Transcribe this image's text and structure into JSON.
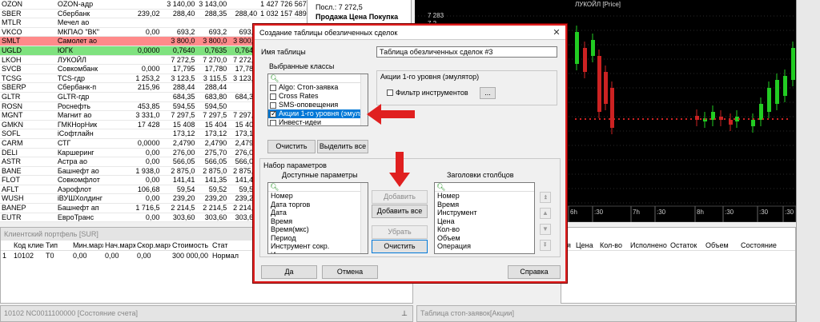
{
  "quotes": [
    {
      "code": "OZON",
      "name": "OZON-адр",
      "c2": "",
      "c3": "3 140,00",
      "c4": "3 143,00",
      "c5": "",
      "c6": "1 427 726 567",
      "style": ""
    },
    {
      "code": "SBER",
      "name": "Сбербанк",
      "c2": "239,02",
      "c3": "288,40",
      "c4": "288,35",
      "c5": "288,40",
      "c6": "1 032 157 489",
      "style": ""
    },
    {
      "code": "MTLR",
      "name": "Мечел ао",
      "c2": "",
      "c3": "",
      "c4": "",
      "c5": "",
      "c6": "",
      "style": ""
    },
    {
      "code": "VKCO",
      "name": "МКПАО \"ВК\"",
      "c2": "0,00",
      "c3": "693,2",
      "c4": "693,2",
      "c5": "693,2",
      "c6": "",
      "style": ""
    },
    {
      "code": "SMLT",
      "name": "Самолет ао",
      "c2": "",
      "c3": "3 800,0",
      "c4": "3 800,0",
      "c5": "3 800,0",
      "c6": "",
      "style": "red"
    },
    {
      "code": "UGLD",
      "name": "ЮГК",
      "c2": "0,0000",
      "c3": "0,7640",
      "c4": "0,7635",
      "c5": "0,7640",
      "c6": "",
      "style": "green"
    },
    {
      "code": "LKOH",
      "name": "ЛУКОЙЛ",
      "c2": "",
      "c3": "7 272,5",
      "c4": "7 270,0",
      "c5": "7 272,5",
      "c6": "",
      "style": ""
    },
    {
      "code": "SVCB",
      "name": "Совкомбанк",
      "c2": "0,000",
      "c3": "17,795",
      "c4": "17,780",
      "c5": "17,780",
      "c6": "",
      "style": ""
    },
    {
      "code": "TCSG",
      "name": "TCS-гдр",
      "c2": "1 253,2",
      "c3": "3 123,5",
      "c4": "3 115,5",
      "c5": "3 123,5",
      "c6": "",
      "style": ""
    },
    {
      "code": "SBERP",
      "name": "Сбербанк-п",
      "c2": "215,96",
      "c3": "288,44",
      "c4": "288,44",
      "c5": "",
      "c6": "",
      "style": ""
    },
    {
      "code": "GLTR",
      "name": "GLTR-гдр",
      "c2": "",
      "c3": "684,35",
      "c4": "683,80",
      "c5": "684,35",
      "c6": "",
      "style": ""
    },
    {
      "code": "ROSN",
      "name": "Роснефть",
      "c2": "453,85",
      "c5": "",
      "c3": "594,55",
      "c4": "594,50",
      "c6": "",
      "style": ""
    },
    {
      "code": "MGNT",
      "name": "Магнит ао",
      "c2": "3 331,0",
      "c3": "7 297,5",
      "c4": "7 297,5",
      "c5": "7 297,5",
      "c6": "",
      "style": ""
    },
    {
      "code": "GMKN",
      "name": "ГМКНорНик",
      "c2": "17 428",
      "c3": "15 408",
      "c4": "15 404",
      "c5": "15 408",
      "c6": "",
      "style": ""
    },
    {
      "code": "SOFL",
      "name": "iСофтлайн",
      "c2": "",
      "c3": "173,12",
      "c4": "173,12",
      "c5": "173,12",
      "c6": "",
      "style": ""
    },
    {
      "code": "CARM",
      "name": "СТГ",
      "c2": "0,0000",
      "c3": "2,4790",
      "c4": "2,4790",
      "c5": "2,4790",
      "c6": "",
      "style": ""
    },
    {
      "code": "DELI",
      "name": "Каршеринг",
      "c2": "0,00",
      "c3": "276,00",
      "c4": "275,70",
      "c5": "276,00",
      "c6": "",
      "style": ""
    },
    {
      "code": "ASTR",
      "name": "Астра ао",
      "c2": "0,00",
      "c3": "566,05",
      "c4": "566,05",
      "c5": "566,05",
      "c6": "",
      "style": ""
    },
    {
      "code": "BANE",
      "name": "Башнефт ао",
      "c2": "1 938,0",
      "c3": "2 875,0",
      "c4": "2 875,0",
      "c5": "2 875,0",
      "c6": "",
      "style": ""
    },
    {
      "code": "FLOT",
      "name": "Совкомфлот",
      "c2": "0,00",
      "c3": "141,41",
      "c4": "141,35",
      "c5": "141,41",
      "c6": "",
      "style": ""
    },
    {
      "code": "AFLT",
      "name": "Аэрофлот",
      "c2": "106,68",
      "c3": "59,54",
      "c4": "59,52",
      "c5": "59,54",
      "c6": "",
      "style": ""
    },
    {
      "code": "WUSH",
      "name": "iВУШХолдинг",
      "c2": "0,00",
      "c3": "239,20",
      "c4": "239,20",
      "c5": "239,20",
      "c6": "",
      "style": ""
    },
    {
      "code": "BANEP",
      "name": "Башнефт ап",
      "c2": "1 716,5",
      "c3": "2 214,5",
      "c4": "2 214,5",
      "c5": "2 214,5",
      "c6": "",
      "style": ""
    },
    {
      "code": "EUTR",
      "name": "ЕвроТранс",
      "c2": "0,00",
      "c3": "303,60",
      "c4": "303,60",
      "c5": "303,60",
      "c6": "",
      "style": ""
    }
  ],
  "quote_panel": {
    "last_label": "Посл.: 7 272,5",
    "header": "Продажа  Цена  Покупка"
  },
  "chart": {
    "title": "ЛУКОЙЛ [Price]",
    "price_label": "7 283",
    "price_label2": "7 2",
    "time_labels": [
      "6h",
      ":30",
      "7h",
      ":30",
      "8h",
      ":30",
      ":30",
      ":30"
    ]
  },
  "portfolio": {
    "title": "Клиентский портфель [SUR]",
    "headers": [
      "",
      "Код клиента",
      "Тип",
      "Мин.маржа",
      "Нач.маржа",
      "Скор.маржа",
      "Стоимость п",
      "Стат"
    ],
    "row": [
      "1",
      "10102",
      "Т0",
      "0,00",
      "0,00",
      "0,00",
      "300 000,00",
      "Нормал"
    ]
  },
  "orders": {
    "headers": [
      "ия",
      "Цена",
      "Кол-во",
      "Исполнено",
      "Остаток",
      "Объем",
      "Состояние"
    ],
    "right_headers": [
      "Ви",
      "Ли",
      "Ли"
    ]
  },
  "bottom": {
    "left": "10102 NC0011100000 [Состояние счета]",
    "right": "Таблица стоп-заявок[Акции]"
  },
  "dialog": {
    "title": "Создание таблицы обезличенных сделок",
    "table_name_label": "Имя таблицы",
    "table_name_value": "Таблица обезличенных сделок #3",
    "selected_classes_label": "Выбранные классы",
    "classes": [
      {
        "label": "Algo: Стоп-заявка",
        "checked": false,
        "selected": false
      },
      {
        "label": "Cross Rates",
        "checked": false,
        "selected": false
      },
      {
        "label": "SMS-оповещения",
        "checked": false,
        "selected": false
      },
      {
        "label": "Акции 1-го уровня (эмулят",
        "checked": true,
        "selected": true
      },
      {
        "label": "Инвест-идеи",
        "checked": false,
        "selected": false
      }
    ],
    "clear_btn": "Очистить",
    "select_all_btn": "Выделить все",
    "class_group_label": "Акции 1-го уровня (эмулятор)",
    "filter_label": "Фильтр инструментов",
    "filter_btn": "...",
    "param_set_label": "Набор параметров",
    "available_label": "Доступные параметры",
    "available_items": [
      "Номер",
      "Дата торгов",
      "Дата",
      "Время",
      "Время(мкс)",
      "Период",
      "Инструмент сокр.",
      "Инструмент"
    ],
    "columns_label": "Заголовки столбцов",
    "column_items": [
      "Номер",
      "Время",
      "Инструмент",
      "Цена",
      "Кол-во",
      "Объем",
      "Операция"
    ],
    "add_btn": "Добавить",
    "add_all_btn": "Добавить все",
    "remove_btn": "Убрать",
    "clear2_btn": "Очистить",
    "ok_btn": "Да",
    "cancel_btn": "Отмена",
    "help_btn": "Справка"
  },
  "colors": {
    "arrow": "#e02020",
    "accent": "#0078d7"
  }
}
